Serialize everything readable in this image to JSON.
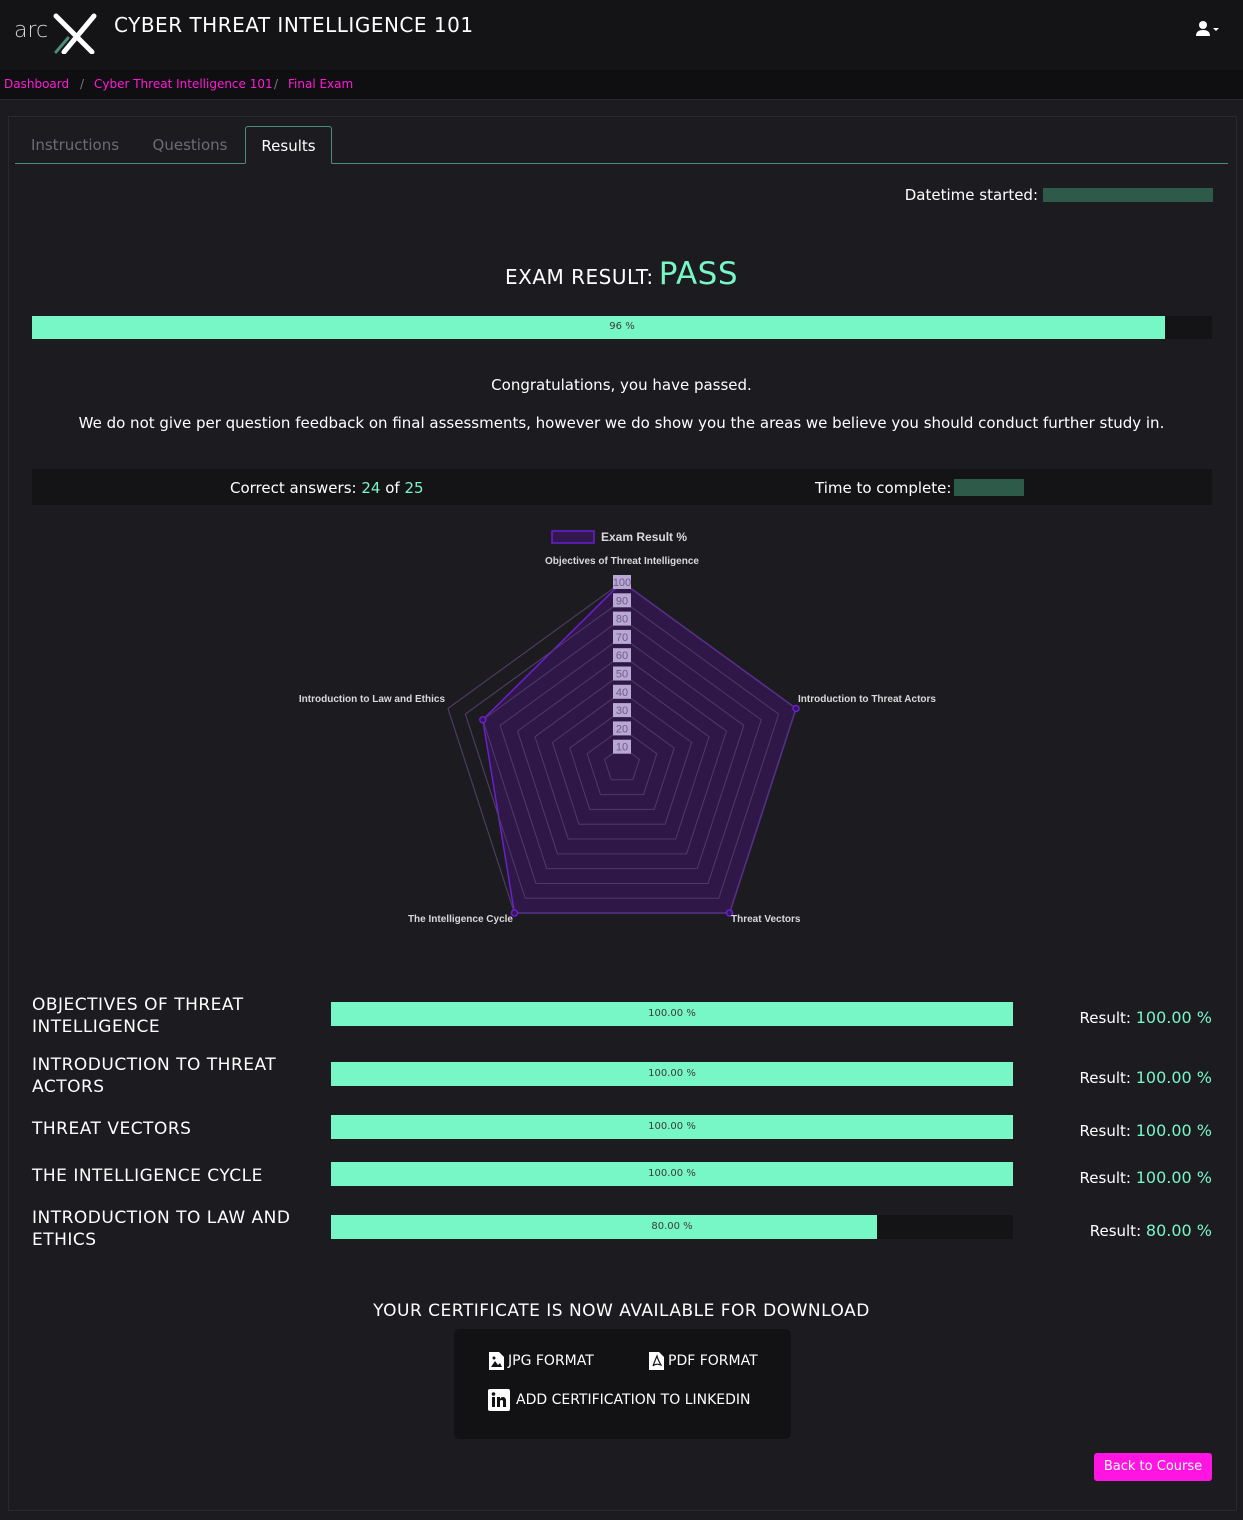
{
  "header": {
    "logo_text": "arcX",
    "title": "CYBER THREAT INTELLIGENCE 101",
    "user_icon": "user-icon",
    "dropdown_icon": "caret-down-icon"
  },
  "breadcrumb": [
    "Dashboard",
    "Cyber Threat Intelligence 101",
    "Final Exam"
  ],
  "tabs": [
    "Instructions",
    "Questions",
    "Results"
  ],
  "active_tab": "Results",
  "datetime_label": "Datetime started:",
  "exam_result": {
    "label": "EXAM RESULT:",
    "value": "PASS",
    "percent": 96,
    "percent_label": "96 %"
  },
  "messages": {
    "congrats": "Congratulations, you have passed.",
    "feedback": "We do not give per question feedback on final assessments, however we do show you the areas we believe you should conduct further study in."
  },
  "stats": {
    "correct_label": "Correct answers:",
    "correct": "24",
    "of": "of",
    "total": "25",
    "time_label": "Time to complete:"
  },
  "chart_data": {
    "type": "radar",
    "legend": "Exam Result %",
    "categories": [
      "Objectives of Threat Intelligence",
      "Introduction to Threat Actors",
      "Threat Vectors",
      "The Intelligence Cycle",
      "Introduction to Law and Ethics"
    ],
    "values": [
      100,
      100,
      100,
      100,
      80
    ],
    "range": [
      0,
      100
    ],
    "ticks": [
      10,
      20,
      30,
      40,
      50,
      60,
      70,
      80,
      90,
      100
    ],
    "series_color": "#6a1fd1",
    "fill_color": "#33184f"
  },
  "areas": [
    {
      "name": "OBJECTIVES OF THREAT INTELLIGENCE",
      "percent": 100,
      "bar_label": "100.00 %",
      "result_label": "Result:",
      "result": "100.00 %"
    },
    {
      "name": "INTRODUCTION TO THREAT ACTORS",
      "percent": 100,
      "bar_label": "100.00 %",
      "result_label": "Result:",
      "result": "100.00 %"
    },
    {
      "name": "THREAT VECTORS",
      "percent": 100,
      "bar_label": "100.00 %",
      "result_label": "Result:",
      "result": "100.00 %"
    },
    {
      "name": "THE INTELLIGENCE CYCLE",
      "percent": 100,
      "bar_label": "100.00 %",
      "result_label": "Result:",
      "result": "100.00 %"
    },
    {
      "name": "INTRODUCTION TO LAW AND ETHICS",
      "percent": 80,
      "bar_label": "80.00 %",
      "result_label": "Result:",
      "result": "80.00 %"
    }
  ],
  "certificate": {
    "title": "YOUR CERTIFICATE IS NOW AVAILABLE FOR DOWNLOAD",
    "jpg": "JPG FORMAT",
    "pdf": "PDF FORMAT",
    "linkedin": "ADD CERTIFICATION TO LINKEDIN"
  },
  "back_button": "Back to Course",
  "colors": {
    "accent_green": "#78f7c6",
    "accent_pink": "#ff14e1",
    "background": "#1c1b20"
  }
}
